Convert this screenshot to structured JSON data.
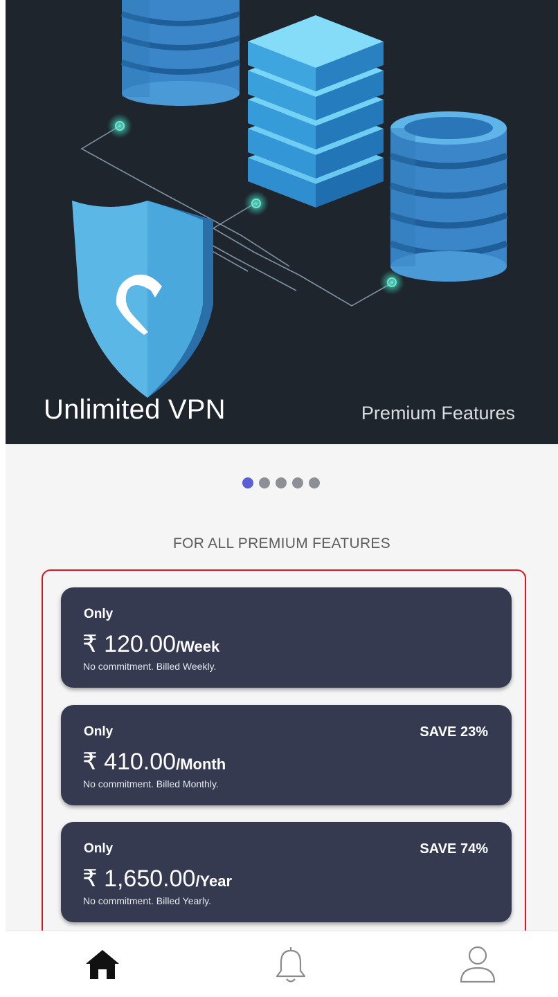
{
  "hero": {
    "title": "Unlimited VPN",
    "subtitle": "Premium Features",
    "background_color": "#1f252d"
  },
  "carousel": {
    "page_count": 5,
    "active_index": 0,
    "active_color": "#5a5fd6"
  },
  "plans_heading": "FOR ALL PREMIUM FEATURES",
  "plans": [
    {
      "only": "Only",
      "amount": "₹ 120.00",
      "period": "/Week",
      "note": "No commitment. Billed Weekly.",
      "save": ""
    },
    {
      "only": "Only",
      "amount": "₹ 410.00",
      "period": "/Month",
      "note": "No commitment. Billed Monthly.",
      "save": "SAVE 23%"
    },
    {
      "only": "Only",
      "amount": "₹ 1,650.00",
      "period": "/Year",
      "note": "No commitment. Billed Yearly.",
      "save": "SAVE 74%"
    }
  ],
  "plan_card_color": "#353a50",
  "highlight_color": "#e0141e",
  "bottom_nav": [
    {
      "icon": "home-icon",
      "active": true
    },
    {
      "icon": "bell-icon",
      "active": false
    },
    {
      "icon": "user-icon",
      "active": false
    }
  ]
}
